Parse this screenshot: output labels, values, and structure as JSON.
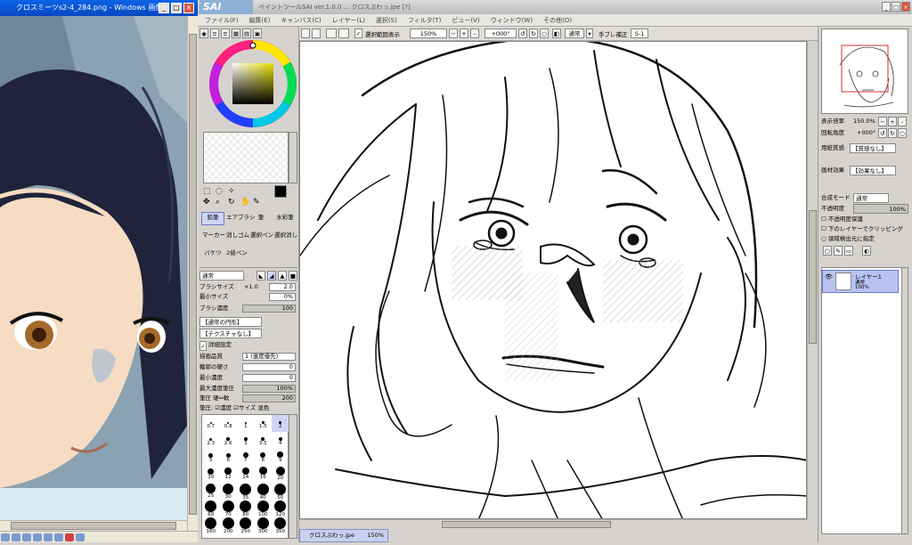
{
  "viewer": {
    "title": "クロスミーツs2-4_284.png - Windows 画像...",
    "buttons": {
      "min": "_",
      "max": "□",
      "close": "×"
    }
  },
  "sai": {
    "logo": "SAI",
    "title": "ペイントツールSAI ver.1.0.0 ... クロスぷわっ.jpe [?]",
    "window_buttons": {
      "min": "_",
      "max": "□",
      "close": "×"
    },
    "menu": [
      "ファイル(F)",
      "編集(E)",
      "キャンバス(C)",
      "レイヤー(L)",
      "選択(S)",
      "フィルタ(T)",
      "ビュー(V)",
      "ウィンドウ(W)",
      "その他(O)"
    ],
    "toolbar": {
      "show_selection": "選択範囲表示",
      "zoom": "150%",
      "rotation": "+000°",
      "blend": "通常",
      "stabilizer_label": "手ブレ補正",
      "stabilizer": "S-1"
    }
  },
  "tools": {
    "brush_tools": [
      "鉛筆",
      "エアブラシ",
      "筆",
      "水彩筆",
      "マーカー",
      "消しゴム",
      "選択ペン",
      "選択消し",
      "バケツ",
      "2値ペン"
    ],
    "blend_mode": "通常",
    "brush_size_label": "ブラシサイズ",
    "brush_size_mult": "×1.0",
    "brush_size": "2.0",
    "min_size_label": "最小サイズ",
    "min_size": "0%",
    "density_label": "ブラシ濃度",
    "density": "100",
    "shape": "【通常の円形】",
    "texture": "【テクスチャなし】",
    "detail_label": "詳細設定",
    "quality_label": "描画品質",
    "quality": "1 (速度優先)",
    "edge_label": "輪郭の硬さ",
    "edge": "0",
    "min_density_label": "最小濃度",
    "min_density": "0",
    "max_pressure_label": "最大濃度筆圧",
    "max_pressure": "100%",
    "pressure_label": "筆圧 硬⇔軟",
    "pressure": "200",
    "pressure_flags": "筆圧: ☑濃度 ☑サイズ 混色",
    "sizes": [
      "0.7",
      "0.8",
      "1",
      "1.5",
      "2",
      "2.3",
      "2.6",
      "3",
      "3.5",
      "4",
      "5",
      "6",
      "7",
      "8",
      "9",
      "10",
      "12",
      "14",
      "16",
      "20",
      "25",
      "30",
      "35",
      "40",
      "50",
      "60",
      "70",
      "80",
      "100",
      "120",
      "160",
      "200",
      "250",
      "300",
      "350"
    ]
  },
  "navigator": {
    "zoom_label": "表示倍率",
    "zoom": "150.0%",
    "angle_label": "回転角度",
    "angle": "+000°"
  },
  "layer_panel": {
    "paper_label": "用紙質感",
    "paper": "【質感なし】",
    "effect_label": "画材効果",
    "effect": "【効果なし】",
    "blend_label": "合成モード",
    "blend": "通常",
    "opacity_label": "不透明度",
    "opacity": "100%",
    "opt1": "不透明度保護",
    "opt2": "下のレイヤーでクリッピング",
    "opt3": "領域検出元に指定",
    "layers": [
      {
        "name": "レイヤー1",
        "mode": "通常",
        "opacity": "100%"
      }
    ]
  },
  "document_tab": {
    "name": "クロスぷわっ.jpe",
    "zoom": "150%"
  },
  "colors": {
    "accent": "#6a78d0",
    "title_blue": "#0a64e6"
  }
}
